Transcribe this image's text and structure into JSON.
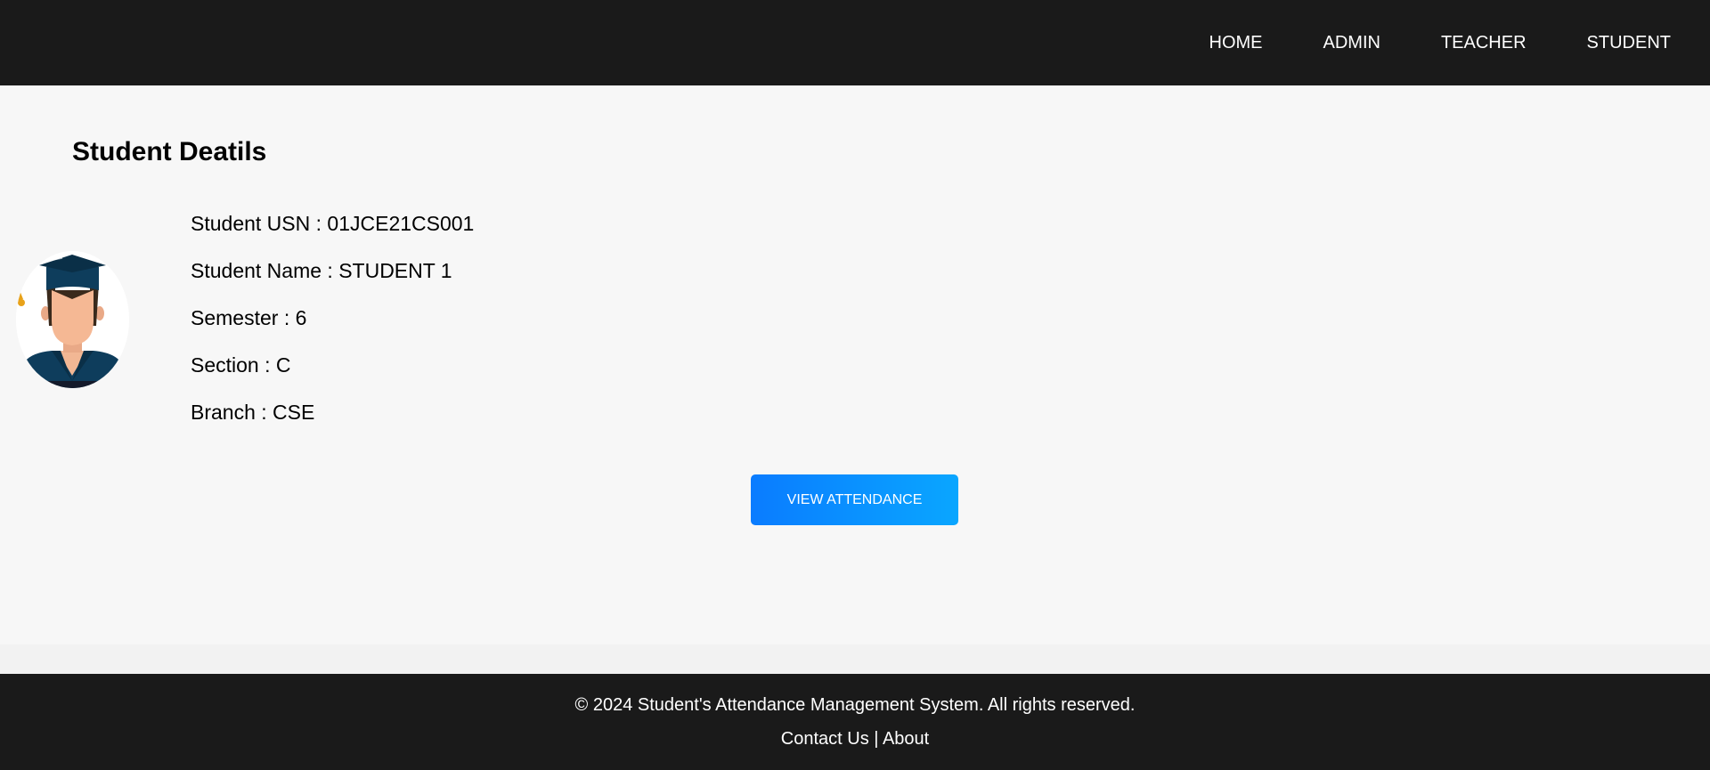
{
  "nav": {
    "items": [
      {
        "label": "HOME"
      },
      {
        "label": "ADMIN"
      },
      {
        "label": "TEACHER"
      },
      {
        "label": "STUDENT"
      }
    ]
  },
  "main": {
    "title": "Student Deatils",
    "avatar_icon": "graduate-student-icon",
    "details": {
      "usn": "Student USN : 01JCE21CS001",
      "name": "Student Name : STUDENT 1",
      "semester": "Semester : 6",
      "section": "Section : C",
      "branch": "Branch : CSE"
    },
    "view_attendance_label": "VIEW ATTENDANCE"
  },
  "footer": {
    "copyright": "© 2024 Student's Attendance Management System. All rights reserved.",
    "contact_label": "Contact Us",
    "separator": " | ",
    "about_label": "About"
  },
  "colors": {
    "header_bg": "#1a1a1a",
    "content_bg": "#f7f7f7",
    "button_gradient_start": "#0a7cff",
    "button_gradient_end": "#0aa6ff",
    "footer_bg": "#1a1a1a"
  }
}
